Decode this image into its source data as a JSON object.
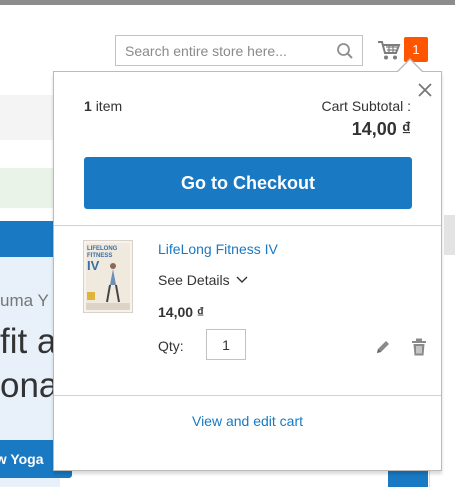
{
  "header": {
    "search": {
      "placeholder": "Search entire store here...",
      "value": "",
      "icon": "search-icon"
    },
    "cart": {
      "icon": "cart-icon",
      "count": "1"
    }
  },
  "background": {
    "hero_subtitle": "uma Y",
    "hero_title_line1": "fit ar",
    "hero_title_line2": "ona",
    "hero_button": "ew Yoga"
  },
  "minicart": {
    "items_count": "1",
    "items_label": "item",
    "subtotal_label": "Cart Subtotal :",
    "subtotal_value": "14,00 ₫",
    "checkout_label": "Go to Checkout",
    "product": {
      "name": "LifeLong Fitness IV",
      "thumb_text_line1": "LIFELONG",
      "thumb_text_line2": "FITNESS",
      "thumb_text_line3": "IV",
      "see_details": "See Details",
      "price": "14,00 ₫",
      "qty_label": "Qty:",
      "qty_value": "1"
    },
    "view_cart_label": "View and edit cart"
  },
  "colors": {
    "accent": "#1979c3",
    "badge": "#ff5501"
  }
}
